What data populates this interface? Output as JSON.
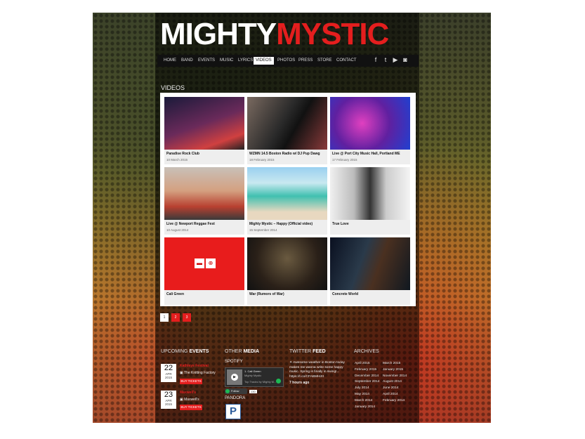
{
  "site": {
    "logo_white": "MIGHTY",
    "logo_red": "MYSTIC"
  },
  "nav": [
    "HOME",
    "BAND",
    "EVENTS",
    "MUSIC",
    "LYRICS",
    "VIDEOS",
    "PHOTOS",
    "PRESS",
    "STORE",
    "CONTACT"
  ],
  "nav_active": "VIDEOS",
  "social_icons": [
    "facebook-icon",
    "twitter-icon",
    "youtube-icon",
    "instagram-icon"
  ],
  "section_title": "VIDEOS",
  "videos": [
    {
      "title": "Paradise Rock Club",
      "date": "10 March 2015"
    },
    {
      "title": "WZMN 14.5 Boston Radio w/ DJ Pup Dawg",
      "date": "18 February 2015"
    },
    {
      "title": "Live @ Port City Music Hall, Portland ME",
      "date": "17 February 2015"
    },
    {
      "title": "Live @ Newport Reggae Fest",
      "date": "10 August 2014"
    },
    {
      "title": "Mighty Mystic – Happy (Official video)",
      "date": "15 September 2014"
    },
    {
      "title": "True Love",
      "date": ""
    },
    {
      "title": "Cali Green",
      "date": ""
    },
    {
      "title": "War (Rumors of War)",
      "date": ""
    },
    {
      "title": "Concrete World",
      "date": ""
    }
  ],
  "pagination": [
    "1",
    "2",
    "3"
  ],
  "footer": {
    "upcoming": {
      "prefix": "UPCOMING",
      "bold": "EVENTS",
      "events": [
        {
          "day": "22",
          "month": "APR",
          "year": "2015",
          "name": "Kathleys Festival",
          "venue": "The Knitting Factory",
          "button": "BUY TICKETS"
        },
        {
          "day": "23",
          "month": "APR",
          "year": "2015",
          "name": "Maxwell's",
          "venue": "Maxwell's",
          "button": "BUY TICKETS"
        }
      ]
    },
    "media": {
      "prefix": "OTHER",
      "bold": "MEDIA",
      "spotify": "SPOTIFY",
      "pandora": "PANDORA",
      "player_line1": "1. Cali Green",
      "player_line2": "Mighty Mystic",
      "player_line3": "Top Tracks by Mighty M...",
      "follow": "Follow",
      "follow_count": "130"
    },
    "twitter": {
      "prefix": "TWITTER",
      "bold": "FEED",
      "tweet": "Awesome weather in Boston today makes me wanna write some happy music. Spring is finally in swing!... https://t.co/CFABMHiXt",
      "time": "7 hours ago"
    },
    "archives": {
      "title": "ARCHIVES",
      "col1": [
        "April 2015",
        "February 2015",
        "December 2014",
        "September 2014",
        "July 2014",
        "May 2014",
        "March 2014",
        "January 2014"
      ],
      "col2": [
        "March 2015",
        "January 2015",
        "November 2014",
        "August 2014",
        "June 2014",
        "April 2014",
        "February 2014"
      ]
    }
  },
  "colors": {
    "accent": "#e41e1e",
    "panel": "#ffffff",
    "nav_bg": "#111111"
  }
}
